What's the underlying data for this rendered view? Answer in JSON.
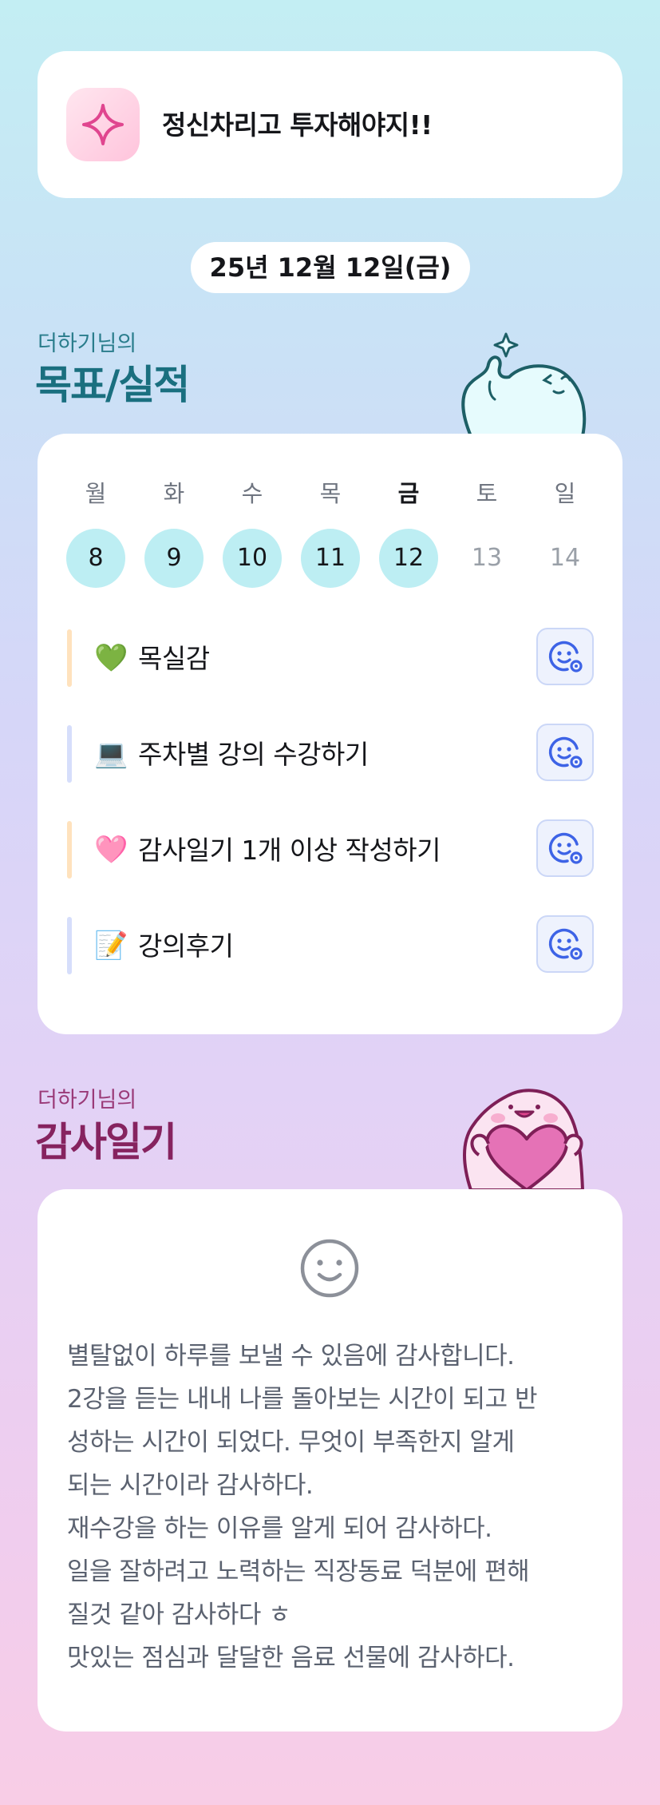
{
  "header": {
    "icon": "sparkle-icon",
    "title": "정신차리고 투자해야지!!"
  },
  "date": "25년 12월 12일(금)",
  "goals_section": {
    "subtitle": "더하기님의",
    "title": "목표/실적",
    "weekdays": [
      "월",
      "화",
      "수",
      "목",
      "금",
      "토",
      "일"
    ],
    "days": [
      "8",
      "9",
      "10",
      "11",
      "12",
      "13",
      "14"
    ],
    "active_day_index": 4,
    "items": [
      {
        "emoji": "💚",
        "label": "목실감",
        "bar_color": "#ffe2bd"
      },
      {
        "emoji": "💻",
        "label": "주차별 강의 수강하기",
        "bar_color": "#d6defb"
      },
      {
        "emoji": "🩷",
        "label": "감사일기 1개 이상 작성하기",
        "bar_color": "#ffe2bd"
      },
      {
        "emoji": "📝",
        "label": "강의후기",
        "bar_color": "#d6defb"
      }
    ],
    "action_icon": "smile-add-icon"
  },
  "diary_section": {
    "subtitle": "더하기님의",
    "title": "감사일기",
    "icon": "smile-icon",
    "text": "별탈없이 하루를 보낼 수 있음에 감사합니다.\n2강을 듣는 내내 나를 돌아보는 시간이 되고 반\n성하는 시간이 되었다. 무엇이 부족한지 알게\n되는 시간이라 감사하다.\n재수강을 하는 이유를 알게 되어 감사하다.\n일을 잘하려고 노력하는 직장동료 덕분에 편해\n질것 같아 감사하다 ㅎ\n맛있는 점심과 달달한 음료 선물에 감사하다."
  },
  "colors": {
    "accent_teal": "#1a6f7f",
    "accent_plum": "#86235f",
    "day_circle": "#bdeef3",
    "action_blue": "#3d63e6"
  }
}
